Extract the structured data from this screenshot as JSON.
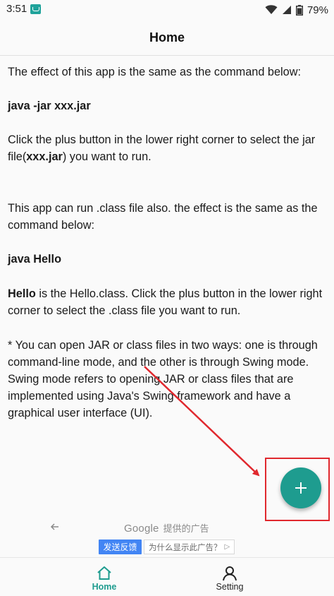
{
  "status_bar": {
    "time": "3:51",
    "battery_percent": "79%",
    "icons": [
      "app-notification-icon",
      "wifi-icon",
      "signal-icon",
      "battery-icon"
    ]
  },
  "header": {
    "title": "Home"
  },
  "content": {
    "intro": "The effect of this app is the same as the command below:",
    "command_jar": "java -jar xxx.jar",
    "click1_before": "Click the plus button in the lower right corner to select the jar file(",
    "click1_bold": "xxx.jar",
    "click1_after": ") you want to run.",
    "class_intro": "This app can run .class file also. the effect is the same as the command below:",
    "command_class": "java Hello",
    "hello_bold": "Hello",
    "hello_rest": " is the Hello.class. Click the plus button in the lower right corner to select the .class file you want to run.",
    "note": "* You can open JAR or class files in two ways: one is through command-line mode, and the other is through Swing mode. Swing mode refers to opening JAR or class files that are implemented using Java's Swing framework and have a graphical user interface (UI)."
  },
  "fab": {
    "icon": "plus-icon"
  },
  "annotation": {
    "color": "#e0282e"
  },
  "ad": {
    "google_logo": "Google",
    "provided_text": "提供的广告",
    "feedback_label": "发送反馈",
    "why_label": "为什么显示此广告？"
  },
  "bottom_nav": {
    "items": [
      {
        "label": "Home",
        "icon": "home-icon",
        "active": true
      },
      {
        "label": "Setting",
        "icon": "person-icon",
        "active": false
      }
    ]
  },
  "colors": {
    "accent": "#1e9c8f",
    "ad_button": "#4285f4"
  }
}
